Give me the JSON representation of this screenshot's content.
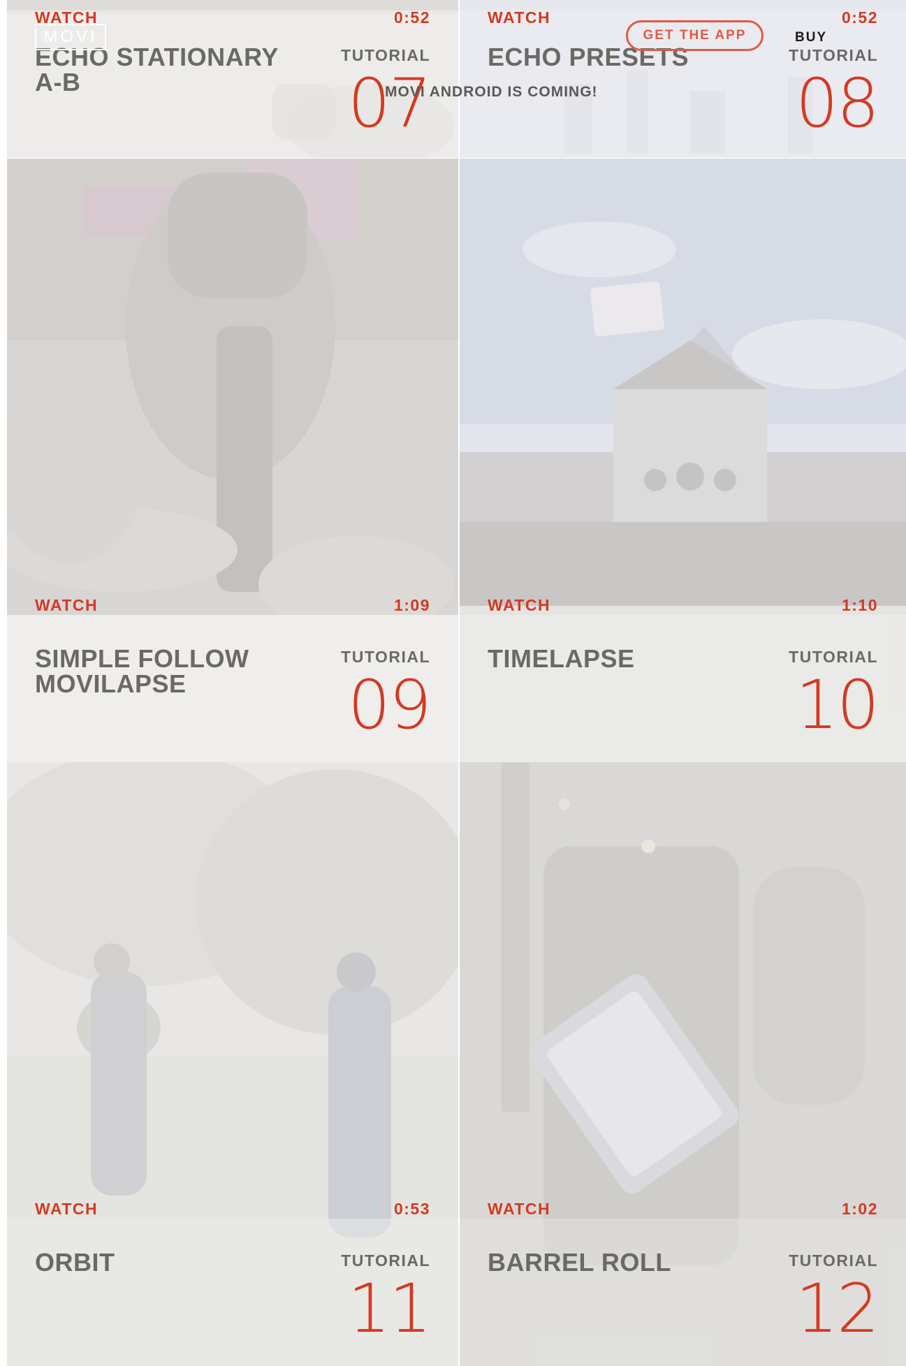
{
  "header": {
    "logo_text": "MOVI",
    "get_app_label": "GET THE APP",
    "buy_label": "BUY",
    "announcement": "MOVI ANDROID IS COMING!"
  },
  "cards": [
    {
      "watch": "WATCH",
      "duration": "0:52",
      "title_lines": [
        "ECHO STATIONARY",
        "A-B"
      ],
      "type_label": "TUTORIAL",
      "number": "07"
    },
    {
      "watch": "WATCH",
      "duration": "0:52",
      "title_lines": [
        "ECHO PRESETS"
      ],
      "type_label": "TUTORIAL",
      "number": "08"
    },
    {
      "watch": "WATCH",
      "duration": "1:09",
      "title_lines": [
        "SIMPLE FOLLOW",
        "MOVILAPSE"
      ],
      "type_label": "TUTORIAL",
      "number": "09"
    },
    {
      "watch": "WATCH",
      "duration": "1:10",
      "title_lines": [
        "TIMELAPSE"
      ],
      "type_label": "TUTORIAL",
      "number": "10"
    },
    {
      "watch": "WATCH",
      "duration": "0:53",
      "title_lines": [
        "ORBIT"
      ],
      "type_label": "TUTORIAL",
      "number": "11"
    },
    {
      "watch": "WATCH",
      "duration": "1:02",
      "title_lines": [
        "BARREL ROLL"
      ],
      "type_label": "TUTORIAL",
      "number": "12"
    }
  ],
  "colors": {
    "accent": "#d33a22",
    "button_outline": "#e15a46",
    "title_gray": "#6a6966"
  }
}
